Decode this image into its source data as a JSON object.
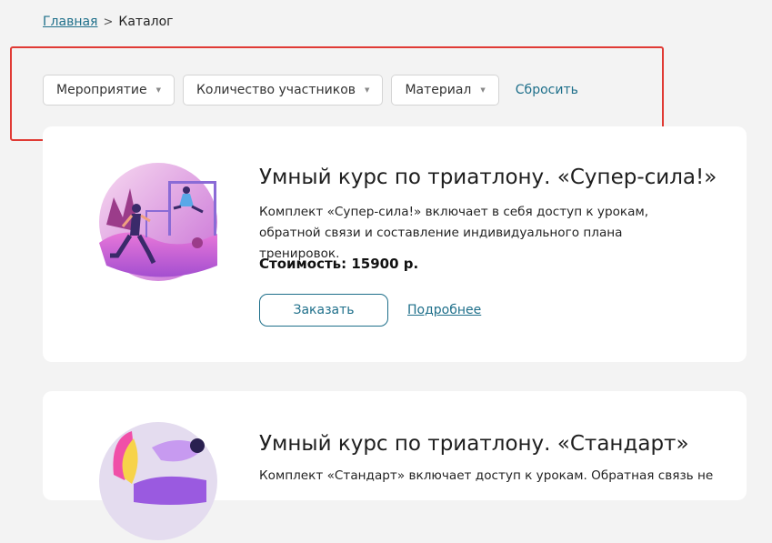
{
  "breadcrumb": {
    "home": "Главная",
    "separator": ">",
    "current": "Каталог"
  },
  "filters": {
    "event": "Мероприятие",
    "participants": "Количество участников",
    "material": "Материал",
    "reset": "Сбросить"
  },
  "products": [
    {
      "title": "Умный курс по триатлону. «Супер-сила!»",
      "description": "Комплект «Супер-сила!» включает в себя доступ к урокам, обратной связи и составление индивидуального плана тренировок.",
      "price": "Стоимость: 15900 р.",
      "order_label": "Заказать",
      "details_label": "Подробнее",
      "illustration": "athlete-illustration"
    },
    {
      "title": "Умный курс по триатлону. «Стандарт»",
      "description": "Комплект «Стандарт» включает доступ к урокам. Обратная связь не",
      "illustration": "swimmer-illustration"
    }
  ],
  "colors": {
    "accent": "#1e6f8a",
    "highlight_border": "#e03a34",
    "page_bg": "#f3f3f3"
  }
}
